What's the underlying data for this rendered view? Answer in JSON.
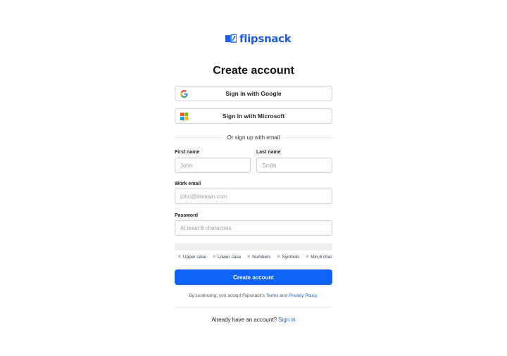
{
  "brand": {
    "name": "flipsnack",
    "color": "#1b5ce6"
  },
  "title": "Create account",
  "sso": {
    "google": {
      "label": "Sign in with Google",
      "icon": "google-icon"
    },
    "microsoft": {
      "label": "Sign in with Microsoft",
      "icon": "microsoft-icon"
    }
  },
  "divider": "Or sign up with email",
  "form": {
    "first_name": {
      "label": "First name",
      "placeholder": "John",
      "value": ""
    },
    "last_name": {
      "label": "Last name",
      "placeholder": "Smith",
      "value": ""
    },
    "work_email": {
      "label": "Work email",
      "placeholder": "john@domain.com",
      "value": ""
    },
    "password": {
      "label": "Password",
      "placeholder": "At least 8 characters",
      "value": ""
    }
  },
  "password_requirements": [
    "Upper case",
    "Lower case",
    "Numbers",
    "Symbols",
    "Min.8 char."
  ],
  "submit_label": "Create account",
  "primary_color": "#0e63f4",
  "legal": {
    "prefix": "By continuing, you accept Flipsnack's",
    "terms": "Terms",
    "and": "and",
    "privacy": "Privacy Policy",
    "suffix": "."
  },
  "footer": {
    "question": "Already have an account?",
    "link": "Sign in"
  }
}
